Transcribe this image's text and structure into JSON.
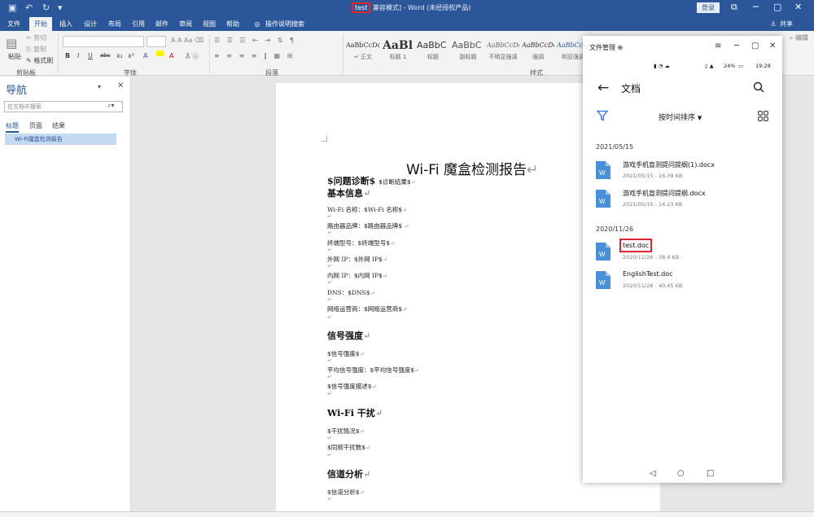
{
  "titlebar": {
    "doc_name": "test",
    "title_rest": "兼容模式] - Word (未经授权产品)",
    "login": "登录",
    "share": "共享"
  },
  "menu": [
    "文件",
    "开始",
    "插入",
    "设计",
    "布局",
    "引用",
    "邮件",
    "审阅",
    "视图",
    "帮助",
    "操作说明搜索"
  ],
  "ribbon": {
    "clipboard": {
      "paste": "粘贴",
      "cut": "剪切",
      "copy": "复制",
      "format_painter": "格式刷",
      "group": "剪贴板"
    },
    "font_group": "字体",
    "paragraph_group": "段落",
    "styles_group": "样式",
    "edit": "编辑",
    "font_buttons": [
      "B",
      "I",
      "U",
      "abc",
      "x₂",
      "x²",
      "A",
      "A"
    ],
    "styles": [
      {
        "preview": "AaBbCcDc",
        "name": "↵ 正文"
      },
      {
        "preview": "AaBl",
        "name": "标题 1"
      },
      {
        "preview": "AaBbC",
        "name": "标题"
      },
      {
        "preview": "AaBbC",
        "name": "副标题"
      },
      {
        "preview": "AaBbCcDc",
        "name": "不明显强调"
      },
      {
        "preview": "AaBbCcDc",
        "name": "强调"
      },
      {
        "preview": "AaBbCcDc",
        "name": "明显强调"
      }
    ]
  },
  "nav": {
    "title": "导航",
    "search_placeholder": "在文档中搜索",
    "tabs": [
      "标题",
      "页面",
      "结果"
    ],
    "item": "Wi-Fi魔盒检测报告"
  },
  "document": {
    "title": "Wi-Fi 魔盒检测报告",
    "h_diagnosis": "$问题诊断$",
    "diagnosis_result": "$诊断结果$",
    "sections": [
      {
        "heading": "基本信息",
        "lines": [
          "Wi-Fi 名称：$Wi-Fi 名称$",
          "路由器品牌：$路由器品牌$",
          "终端型号：$终端型号$",
          "外网 IP：$外网 IP$",
          "内网 IP：$内网 IP$",
          "DNS：$DNS$",
          "网络运营商：$网络运营商$"
        ]
      },
      {
        "heading": "信号强度",
        "lines": [
          "$信号强度$",
          "平均信号强度：$平均信号强度$",
          "$信号强度描述$"
        ]
      },
      {
        "heading": "Wi-Fi 干扰",
        "lines": [
          "$干扰情况$",
          "$同频干扰数$"
        ]
      },
      {
        "heading": "信道分析",
        "lines": [
          "$信道分析$"
        ]
      }
    ]
  },
  "file_manager": {
    "title": "文件管理",
    "time": "19:28",
    "battery": "24%",
    "heading": "文档",
    "sort": "按时间排序",
    "groups": [
      {
        "date": "2021/05/15",
        "files": [
          {
            "name": "游戏手机盲测提问提纲(1).docx",
            "meta": "2021/05/15 - 16.39 KB"
          },
          {
            "name": "游戏手机盲测提问提纲.docx",
            "meta": "2021/05/15 - 14.23 KB"
          }
        ]
      },
      {
        "date": "2020/11/26",
        "files": [
          {
            "name": "test.doc",
            "meta": "2020/11/26 - 38.4 KB"
          },
          {
            "name": "EnglishTest.doc",
            "meta": "2020/11/26 - 40.45 KB"
          }
        ]
      }
    ]
  },
  "colors": {
    "word_blue": "#2b579a",
    "highlight_red": "#e0262a",
    "doc_icon": "#4a8fd9"
  }
}
